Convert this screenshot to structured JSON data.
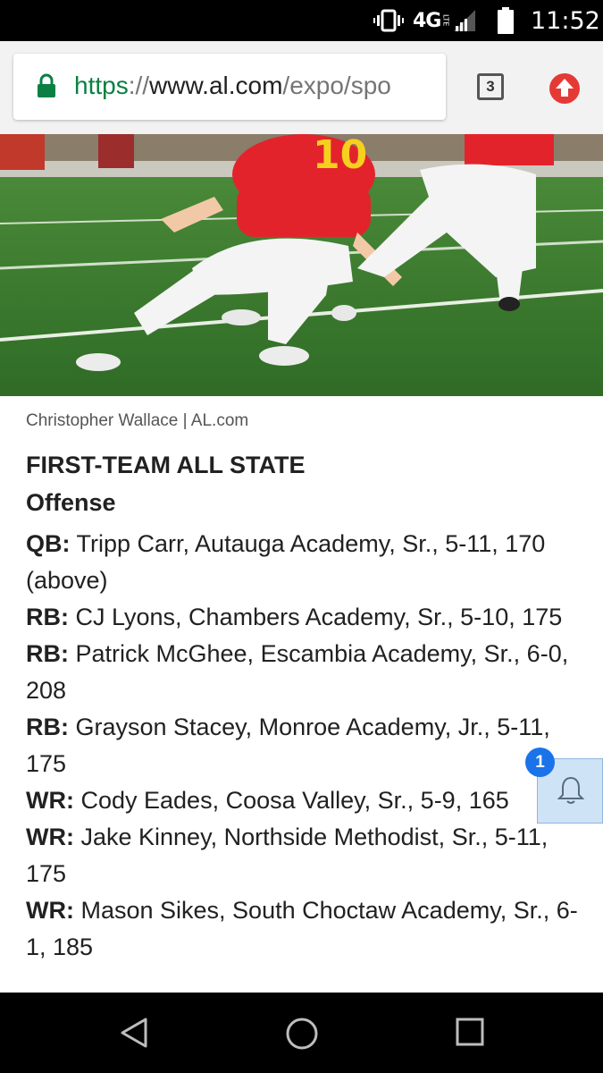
{
  "status_bar": {
    "network": "4G",
    "network_sub": "LTE",
    "time": "11:52",
    "icons": [
      "vibrate-icon",
      "network-4g-lte-icon",
      "signal-icon",
      "battery-icon"
    ]
  },
  "browser": {
    "url": {
      "scheme": "https",
      "separator": "://",
      "host": "www.al.com",
      "path": "/expo/spo"
    },
    "tab_count": "3",
    "icons": [
      "lock-icon",
      "tabs-icon",
      "upload-icon"
    ]
  },
  "article": {
    "photo_credit": "Christopher Wallace | AL.com",
    "heading": "FIRST-TEAM ALL STATE",
    "subheading": "Offense",
    "entries": [
      {
        "pos": "QB:",
        "text": " Tripp Carr, Autauga Academy, Sr., 5-11, 170 (above)"
      },
      {
        "pos": "RB:",
        "text": " CJ Lyons, Chambers Academy, Sr., 5-10, 175"
      },
      {
        "pos": "RB:",
        "text": " Patrick McGhee, Escambia Academy, Sr., 6-0, 208"
      },
      {
        "pos": "RB:",
        "text": " Grayson Stacey, Monroe Academy, Jr., 5-11, 175"
      },
      {
        "pos": "WR:",
        "text": " Cody Eades, Coosa Valley, Sr., 5-9, 165"
      },
      {
        "pos": "WR:",
        "text": " Jake Kinney, Northside Methodist, Sr., 5-11, 175"
      },
      {
        "pos": "WR:",
        "text": " Mason Sikes, South Choctaw Academy, Sr., 6-1, 185"
      }
    ]
  },
  "notification": {
    "badge_count": "1",
    "icon": "bell-icon"
  },
  "nav_bar": {
    "icons": [
      "back-icon",
      "home-icon",
      "recents-icon"
    ]
  },
  "colors": {
    "url_green": "#0b8043",
    "accent_blue": "#1a73e8",
    "upload_red": "#e53935"
  }
}
